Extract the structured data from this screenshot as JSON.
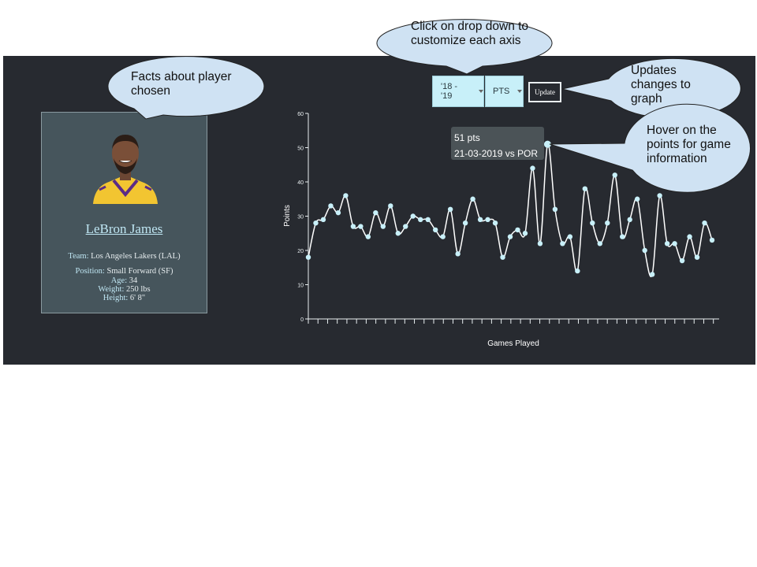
{
  "player": {
    "name": "LeBron James",
    "team_label": "Team:",
    "team": "Los Angeles Lakers (LAL)",
    "position_label": "Position:",
    "position": "Small Forward (SF)",
    "age_label": "Age:",
    "age": "34",
    "weight_label": "Weight:",
    "weight": "250 lbs",
    "height_label": "Height:",
    "height": "6' 8\""
  },
  "controls": {
    "season": "'18 - '19",
    "stat": "PTS",
    "update_label": "Update"
  },
  "tooltip": {
    "line1": "51 pts",
    "line2": "21-03-2019 vs POR"
  },
  "annotations": {
    "facts": "Facts about player chosen",
    "dropdown": "Click on drop down to customize each axis",
    "update": "Updates changes to graph",
    "hover": "Hover on the points for game information"
  },
  "colors": {
    "background": "#272a30",
    "line": "#ffffff",
    "point": "#c8f0f9",
    "bubble_fill": "#cfe2f3"
  },
  "chart_data": {
    "type": "line",
    "title": "",
    "xlabel": "Games Played",
    "ylabel": "Points",
    "ylim": [
      0,
      60
    ],
    "yticks": [
      0,
      10,
      20,
      30,
      40,
      50,
      60
    ],
    "grid": false,
    "y": [
      18,
      28,
      29,
      33,
      31,
      36,
      27,
      27,
      24,
      31,
      27,
      33,
      25,
      27,
      30,
      29,
      29,
      26,
      24,
      32,
      19,
      28,
      35,
      29,
      29,
      28,
      18,
      24,
      26,
      25,
      44,
      22,
      51,
      32,
      22,
      24,
      14,
      38,
      28,
      22,
      28,
      42,
      24,
      29,
      35,
      20,
      13,
      36,
      22,
      22,
      17,
      24,
      18,
      28,
      23
    ]
  }
}
